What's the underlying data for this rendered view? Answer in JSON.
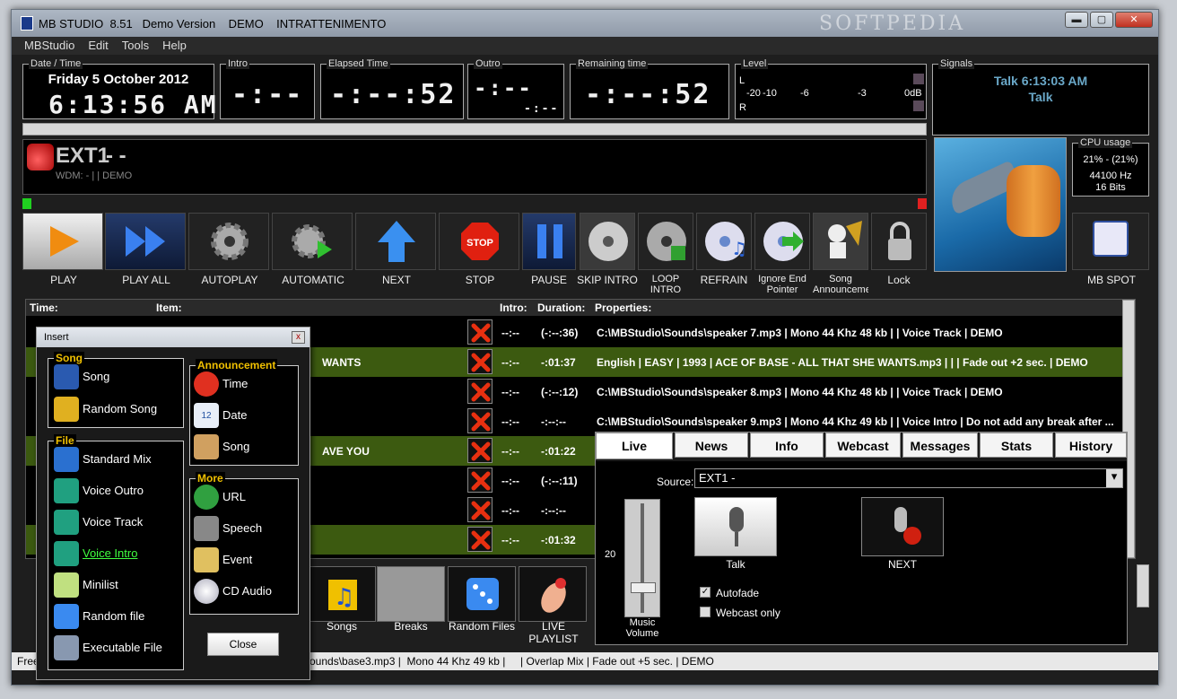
{
  "window": {
    "title": "MB STUDIO  8.51   Demo Version    DEMO    INTRATTENIMENTO",
    "watermark": "SOFTPEDIA",
    "minimize": "▬",
    "maximize": "▢",
    "close": "✕"
  },
  "menu": [
    "MBStudio",
    "Edit",
    "Tools",
    "Help"
  ],
  "clock": {
    "label": "Date / Time",
    "date": "Friday 5 October 2012",
    "time": "6:13:56 AM"
  },
  "intro": {
    "label": "Intro",
    "value": "-:--"
  },
  "elapsed": {
    "label": "Elapsed Time",
    "value": "-:--:52"
  },
  "outro": {
    "label": "Outro",
    "value": "-:--",
    "sub": "-:--"
  },
  "remaining": {
    "label": "Remaining time",
    "value": "-:--:52"
  },
  "level": {
    "label": "Level",
    "l": "L",
    "r": "R",
    "scale": [
      "-20",
      "-10",
      "-6",
      "-3",
      "0dB"
    ]
  },
  "signals": {
    "label": "Signals",
    "line1": "Talk 6:13:03 AM",
    "line2": "Talk"
  },
  "cpu": {
    "label": "CPU usage",
    "percent": "21% - (21%)",
    "hz": "44100 Hz",
    "bits": "16 Bits"
  },
  "source": {
    "name": "EXT1",
    "dash": "-  -",
    "info": "WDM: - | | DEMO"
  },
  "buttons": [
    "PLAY",
    "PLAY ALL",
    "AUTOPLAY",
    "AUTOMATIC",
    "NEXT",
    "STOP",
    "PAUSE",
    "SKIP INTRO",
    "LOOP INTRO",
    "REFRAIN",
    "Ignore End Pointer",
    "Song Announcement",
    "Lock"
  ],
  "stop_text": "STOP",
  "mbspot": "MB SPOT",
  "grid": {
    "headers": {
      "time": "Time:",
      "item": "Item:",
      "intro": "Intro:",
      "duration": "Duration:",
      "properties": "Properties:"
    },
    "rows": [
      {
        "item": "",
        "intro": "--:--",
        "duration": "(-:--:36)",
        "props": "C:\\MBStudio\\Sounds\\speaker 7.mp3 |  Mono 44 Khz 48 kb |  | Voice Track | DEMO",
        "green": false
      },
      {
        "item": "WANTS",
        "intro": "--:--",
        "duration": "-:01:37",
        "props": "English | EASY | 1993 | ACE OF BASE - ALL THAT SHE WANTS.mp3 |  |  | Fade out +2 sec. | DEMO",
        "green": true
      },
      {
        "item": "",
        "intro": "--:--",
        "duration": "(-:--:12)",
        "props": "C:\\MBStudio\\Sounds\\speaker 8.mp3 |  Mono 44 Khz 48 kb |  | Voice Track | DEMO",
        "green": false
      },
      {
        "item": "",
        "intro": "--:--",
        "duration": "-:--:--",
        "props": "C:\\MBStudio\\Sounds\\speaker 9.mp3 |  Mono 44 Khz 49 kb |  | Voice Intro | Do not add any break after ...",
        "green": false
      },
      {
        "item": "AVE YOU",
        "intro": "--:--",
        "duration": "-:01:22",
        "props": "",
        "green": true
      },
      {
        "item": "",
        "intro": "--:--",
        "duration": "(-:--:11)",
        "props": "",
        "green": false
      },
      {
        "item": "",
        "intro": "--:--",
        "duration": "-:--:--",
        "props": "",
        "green": false
      },
      {
        "item": "",
        "intro": "--:--",
        "duration": "-:01:32",
        "props": "",
        "green": true
      }
    ]
  },
  "bottom": {
    "songs": "Songs",
    "breaks": "Breaks",
    "random": "Random Files",
    "live": "LIVE PLAYLIST"
  },
  "insert": {
    "title": "Insert",
    "close_x": "x",
    "close": "Close",
    "song_group": "Song",
    "song_items": [
      "Song",
      "Random Song"
    ],
    "file_group": "File",
    "file_items": [
      "Standard Mix",
      "Voice Outro",
      "Voice Track",
      "Voice Intro",
      "Minilist",
      "Random file",
      "Executable File"
    ],
    "ann_group": "Announcement",
    "ann_items": [
      "Time",
      "Date",
      "Song"
    ],
    "more_group": "More",
    "more_items": [
      "URL",
      "Speech",
      "Event",
      "CD Audio"
    ],
    "date_icon": "12"
  },
  "tabs": {
    "items": [
      "Live",
      "News",
      "Info",
      "Webcast",
      "Messages",
      "Stats",
      "History"
    ],
    "source_label": "Source:",
    "source_value": "EXT1 -",
    "talk": "Talk",
    "next": "NEXT",
    "volume_value": "20",
    "volume_label": "Music Volume",
    "autofade": "Autofade",
    "webcast_only": "Webcast only"
  },
  "status": "Free",
  "status_rest": "ounds\\base3.mp3 |  Mono 44 Khz 49 kb |     | Overlap Mix | Fade out +5 sec. | DEMO"
}
